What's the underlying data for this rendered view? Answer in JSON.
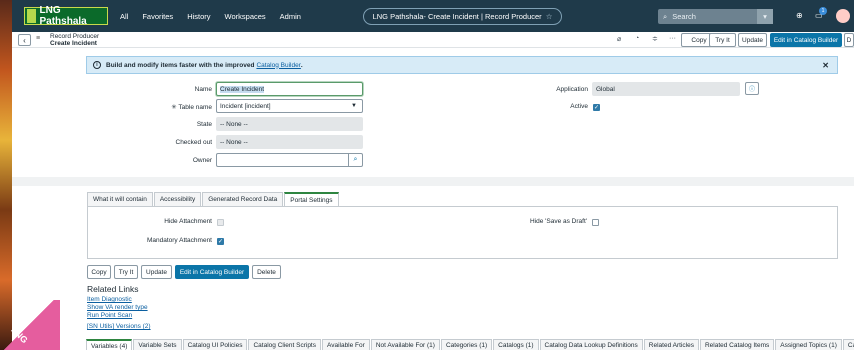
{
  "topbar": {
    "logo": "LNG Pathshala",
    "nav": [
      "All",
      "Favorites",
      "History",
      "Workspaces",
      "Admin"
    ],
    "context_title": "LNG Pathshala- Create Incident | Record Producer",
    "search_placeholder": "Search",
    "notification_count": "1"
  },
  "formbar": {
    "record_type": "Record Producer",
    "record_name": "Create Incident",
    "buttons": {
      "copy": "Copy",
      "try_it": "Try It",
      "update": "Update",
      "catalog_builder": "Edit in Catalog Builder",
      "overflow": "D"
    }
  },
  "info": {
    "message": "Build and modify items faster with the improved",
    "link": "Catalog Builder",
    "suffix": "."
  },
  "form": {
    "name_label": "Name",
    "name_value": "Create Incident",
    "table_label": "Table name",
    "table_value": "Incident [incident]",
    "state_label": "State",
    "state_value": "-- None --",
    "checked_out_label": "Checked out",
    "checked_out_value": "-- None --",
    "owner_label": "Owner",
    "owner_value": "",
    "application_label": "Application",
    "application_value": "Global",
    "active_label": "Active",
    "active_checked": true,
    "required_mark": "✳"
  },
  "tabs": [
    "What it will contain",
    "Accessibility",
    "Generated Record Data",
    "Portal Settings"
  ],
  "portal": {
    "hide_attachment": "Hide Attachment",
    "mandatory_attachment": "Mandatory Attachment",
    "hide_save_draft": "Hide 'Save as Draft'"
  },
  "bottom_buttons": {
    "copy": "Copy",
    "try_it": "Try It",
    "update": "Update",
    "catalog_builder": "Edit in Catalog Builder",
    "delete": "Delete"
  },
  "related": {
    "title": "Related Links",
    "links": [
      "Item Diagnostic",
      "Show VA render type",
      "Run Point Scan",
      "[SN Utils] Versions (2)"
    ]
  },
  "related_tabs": [
    "Variables (4)",
    "Variable Sets",
    "Catalog UI Policies",
    "Catalog Client Scripts",
    "Available For",
    "Not Available For (1)",
    "Categories (1)",
    "Catalogs (1)",
    "Catalog Data Lookup Definitions",
    "Related Articles",
    "Related Catalog Items",
    "Assigned Topics (1)",
    "Ca"
  ],
  "decor": {
    "corner_text": "LNG"
  },
  "colors": {
    "header": "#1f3a4a",
    "primary": "#0b75a8",
    "info_bg": "#d7ebf7",
    "active_tab": "#2e8540"
  }
}
